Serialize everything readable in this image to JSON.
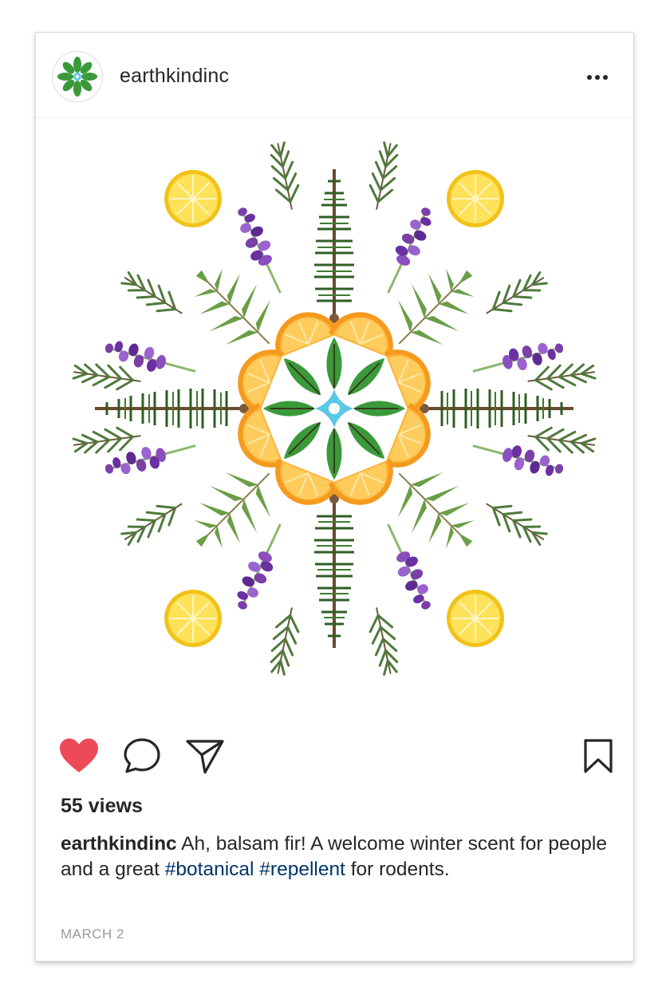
{
  "post": {
    "username": "earthkindinc",
    "more_icon": "more-horizontal-icon",
    "views": "55 views",
    "caption": {
      "user": "earthkindinc",
      "text_1": " Ah, balsam fir! A welcome winter scent for people and a great ",
      "tag_1": "#botanical",
      "text_2": " ",
      "tag_2": "#repellent",
      "text_3": " for rodents."
    },
    "date": "MARCH 2",
    "liked": true
  },
  "actions": {
    "like_icon": "heart-filled-icon",
    "comment_icon": "comment-icon",
    "share_icon": "paper-plane-icon",
    "save_icon": "bookmark-icon"
  },
  "colors": {
    "like_red": "#ed4956",
    "hashtag_blue": "#003569",
    "leaf_green": "#3a9a3a",
    "logo_blue": "#5bc8e6",
    "lavender": "#7b3fa8",
    "lemon": "#f4c51c",
    "orange": "#f59a1e",
    "fir_green": "#2f5e23"
  }
}
